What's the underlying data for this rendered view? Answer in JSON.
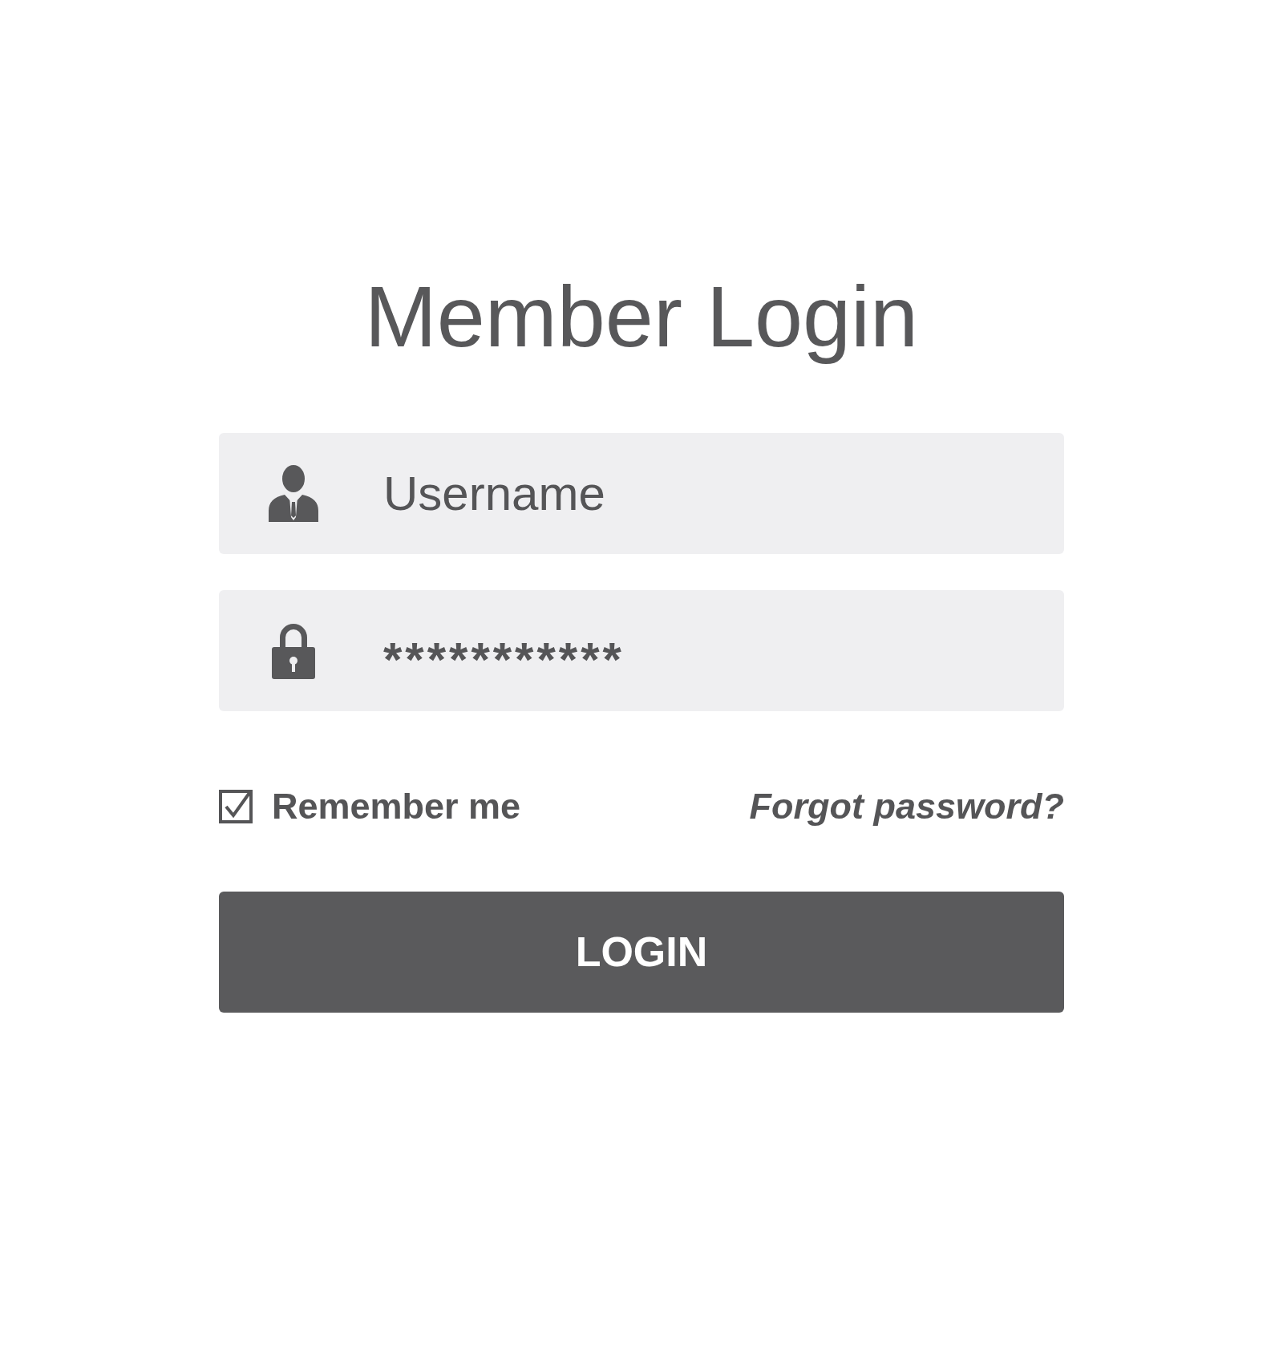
{
  "title": "Member Login",
  "username": {
    "placeholder": "Username"
  },
  "password": {
    "value": "***********"
  },
  "remember": {
    "label": "Remember me",
    "checked": true
  },
  "forgot_link": "Forgot password?",
  "login_button": "LOGIN"
}
